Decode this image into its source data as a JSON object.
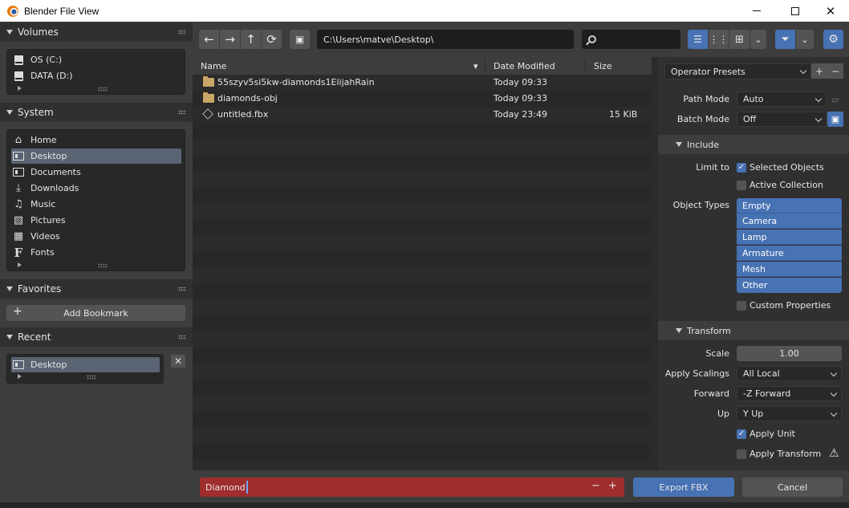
{
  "window": {
    "title": "Blender File View"
  },
  "volumes": {
    "header": "Volumes",
    "items": [
      {
        "label": "OS (C:)"
      },
      {
        "label": "DATA (D:)"
      }
    ]
  },
  "system": {
    "header": "System",
    "items": [
      {
        "label": "Home",
        "icon": "home-icon"
      },
      {
        "label": "Desktop",
        "icon": "desktop-icon",
        "active": true
      },
      {
        "label": "Documents",
        "icon": "documents-icon"
      },
      {
        "label": "Downloads",
        "icon": "download-icon"
      },
      {
        "label": "Music",
        "icon": "music-icon"
      },
      {
        "label": "Pictures",
        "icon": "pictures-icon"
      },
      {
        "label": "Videos",
        "icon": "videos-icon"
      },
      {
        "label": "Fonts",
        "icon": "font-icon"
      }
    ]
  },
  "favorites": {
    "header": "Favorites",
    "add_bookmark": "Add Bookmark"
  },
  "recent": {
    "header": "Recent",
    "items": [
      {
        "label": "Desktop"
      }
    ]
  },
  "toolbar": {
    "path": "C:\\Users\\matve\\Desktop\\",
    "search_value": ""
  },
  "filelist": {
    "columns": {
      "name": "Name",
      "date": "Date Modified",
      "size": "Size"
    },
    "files": [
      {
        "name": "55szyv5si5kw-diamonds1ElijahRain",
        "date": "Today 09:33",
        "size": "",
        "type": "folder"
      },
      {
        "name": "diamonds-obj",
        "date": "Today 09:33",
        "size": "",
        "type": "folder"
      },
      {
        "name": "untitled.fbx",
        "date": "Today 23:49",
        "size": "15 KiB",
        "type": "file"
      }
    ]
  },
  "settings": {
    "operator_presets": "Operator Presets",
    "path_mode_label": "Path Mode",
    "path_mode_value": "Auto",
    "batch_mode_label": "Batch Mode",
    "batch_mode_value": "Off",
    "include": {
      "header": "Include",
      "limit_to_label": "Limit to",
      "selected_objects": {
        "label": "Selected Objects",
        "checked": true
      },
      "active_collection": {
        "label": "Active Collection",
        "checked": false
      },
      "object_types_label": "Object Types",
      "object_types": [
        "Empty",
        "Camera",
        "Lamp",
        "Armature",
        "Mesh",
        "Other"
      ],
      "custom_properties": {
        "label": "Custom Properties",
        "checked": false
      }
    },
    "transform": {
      "header": "Transform",
      "scale_label": "Scale",
      "scale_value": "1.00",
      "apply_scalings_label": "Apply Scalings",
      "apply_scalings_value": "All Local",
      "forward_label": "Forward",
      "forward_value": "-Z Forward",
      "up_label": "Up",
      "up_value": "Y Up",
      "apply_unit": {
        "label": "Apply Unit",
        "checked": true
      },
      "apply_transform": {
        "label": "Apply Transform",
        "checked": false
      }
    }
  },
  "bottom": {
    "filename": "Diamond",
    "export_label": "Export FBX",
    "cancel_label": "Cancel"
  },
  "colors": {
    "accent": "#4772b3",
    "filename_bg": "#9f2d2d",
    "panel": "#303030",
    "list": "#2b2b2b"
  }
}
